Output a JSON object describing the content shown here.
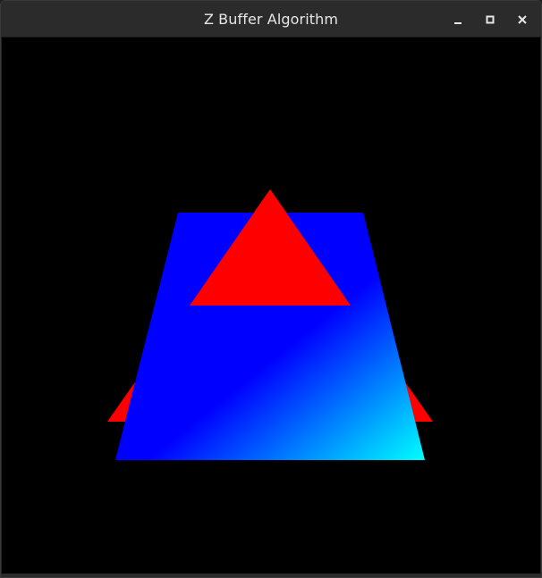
{
  "window": {
    "title": "Z Buffer Algorithm",
    "controls": {
      "minimize_icon": "minimize-icon",
      "maximize_icon": "maximize-icon",
      "close_icon": "close-icon"
    }
  },
  "scene": {
    "background_color": "#000000",
    "triangle_color": "#ff0000",
    "quad_gradient": [
      "#0000ff",
      "#0000ff",
      "#00ffff"
    ]
  }
}
